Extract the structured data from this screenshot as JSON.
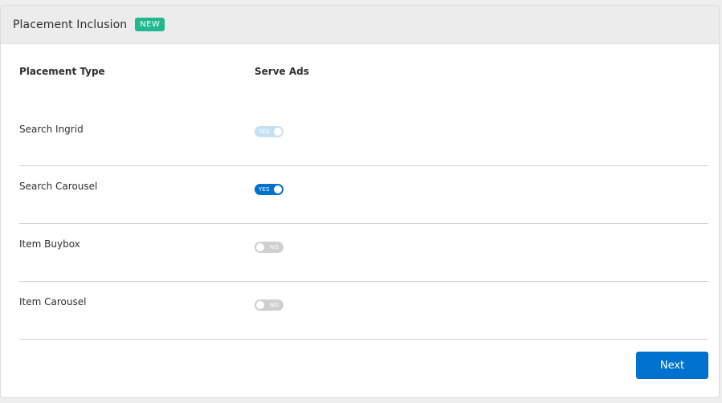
{
  "header": {
    "title": "Placement Inclusion",
    "badge": "NEW"
  },
  "table": {
    "columns": [
      "Placement Type",
      "Serve Ads"
    ],
    "rows": [
      {
        "label": "Search Ingrid",
        "toggle_text": "YES",
        "state": "on-disabled"
      },
      {
        "label": "Search Carousel",
        "toggle_text": "YES",
        "state": "on"
      },
      {
        "label": "Item Buybox",
        "toggle_text": "NO",
        "state": "off"
      },
      {
        "label": "Item Carousel",
        "toggle_text": "NO",
        "state": "off"
      }
    ]
  },
  "actions": {
    "next_label": "Next"
  },
  "colors": {
    "primary": "#0071ce",
    "badge": "#1fb88f",
    "toggle_off": "#cfd0d2",
    "toggle_disabled": "#c5dff5"
  }
}
